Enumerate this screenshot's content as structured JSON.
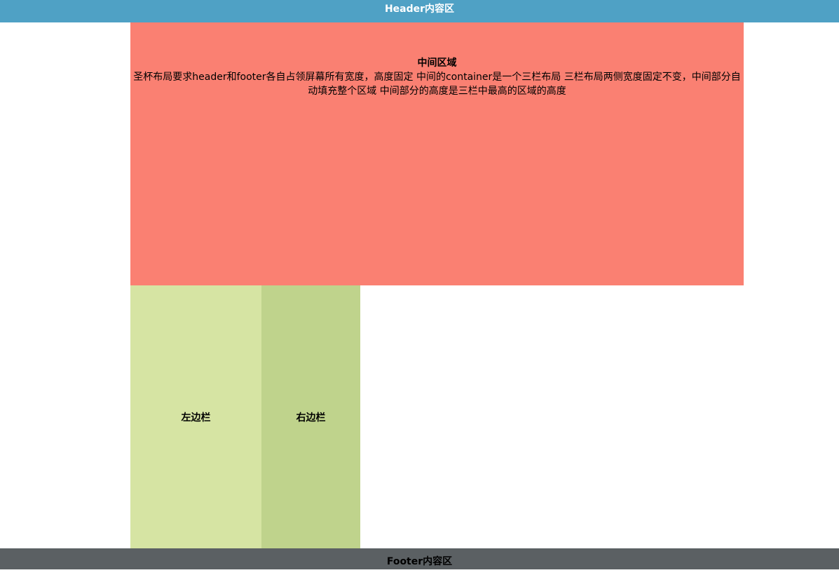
{
  "header": {
    "text": "Header内容区"
  },
  "main": {
    "title": "中间区域",
    "text": "圣杯布局要求header和footer各自占领屏幕所有宽度，高度固定 中间的container是一个三栏布局 三栏布局两侧宽度固定不变，中间部分自动填充整个区域 中间部分的高度是三栏中最高的区域的高度"
  },
  "left_sidebar": {
    "text": "左边栏"
  },
  "right_sidebar": {
    "text": "右边栏"
  },
  "footer": {
    "text": "Footer内容区"
  },
  "colors": {
    "header_bg": "#4fa1c5",
    "main_bg": "#fa8072",
    "left_bg": "#d6e4a3",
    "right_bg": "#bfd38c",
    "footer_bg": "#5b6063"
  }
}
